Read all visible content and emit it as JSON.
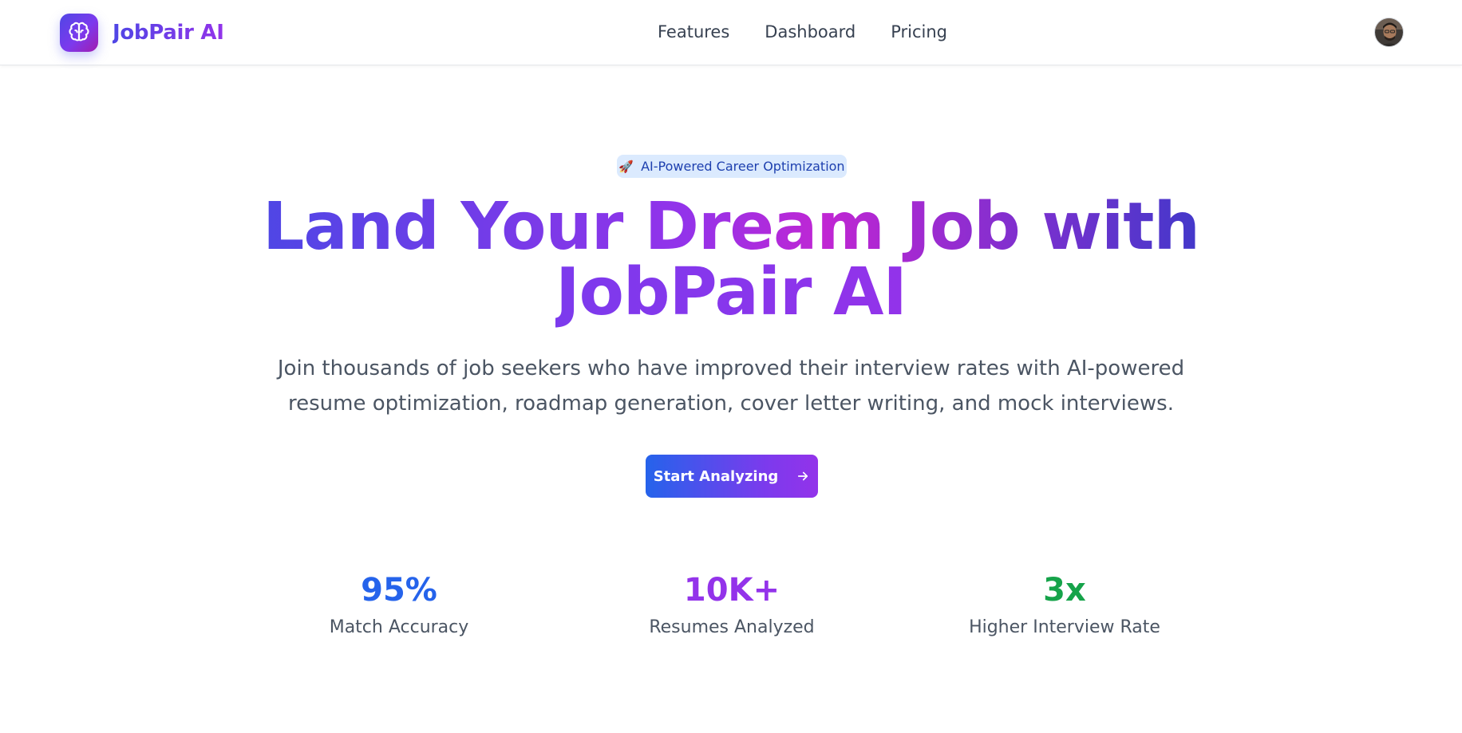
{
  "brand": {
    "name": "JobPair AI",
    "logo_icon": "brain-icon"
  },
  "nav": {
    "links": [
      {
        "label": "Features"
      },
      {
        "label": "Dashboard"
      },
      {
        "label": "Pricing"
      }
    ],
    "avatar_icon": "user-avatar"
  },
  "hero": {
    "badge_emoji": "🚀",
    "badge_text": "AI-Powered Career Optimization",
    "headline_line1": "Land Your Dream Job with",
    "headline_line2": "JobPair AI",
    "subtitle": "Join thousands of job seekers who have improved their interview rates with AI-powered resume optimization, roadmap generation, cover letter writing, and mock interviews.",
    "cta_label": "Start Analyzing",
    "cta_icon": "arrow-right-icon"
  },
  "stats": [
    {
      "value": "95%",
      "label": "Match Accuracy",
      "color": "#2563eb"
    },
    {
      "value": "10K+",
      "label": "Resumes Analyzed",
      "color": "#9333ea"
    },
    {
      "value": "3x",
      "label": "Higher Interview Rate",
      "color": "#16a34a"
    }
  ],
  "colors": {
    "primary": "#4f46e5",
    "accent": "#9333ea",
    "badge_bg": "#dbeafe",
    "badge_text": "#1e40af"
  }
}
